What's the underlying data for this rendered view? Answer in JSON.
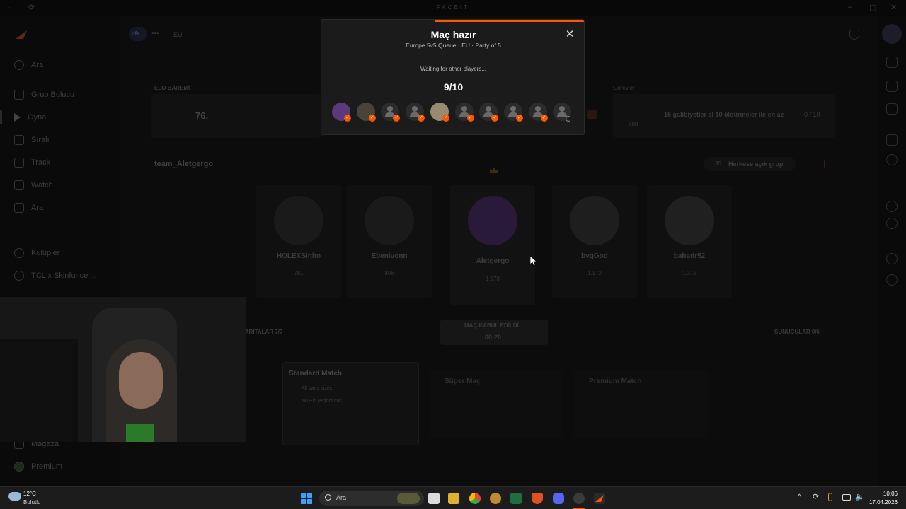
{
  "app": {
    "title": "FACEIT"
  },
  "sidebar": {
    "items": [
      {
        "label": "Ara"
      },
      {
        "label": "Grup Bulucu"
      },
      {
        "label": "Oyna"
      },
      {
        "label": "Sıralı"
      },
      {
        "label": "Track"
      },
      {
        "label": "Watch"
      },
      {
        "label": "Ara"
      },
      {
        "label": "Kulüpler"
      },
      {
        "label": "TCL x Skinfunce ..."
      },
      {
        "label": "Mağaza"
      },
      {
        "label": "Premium"
      }
    ]
  },
  "topbar": {
    "game_tag": "cfs",
    "region": "EU"
  },
  "stats": {
    "elo_label": "ELO BAREMİ",
    "elo_value": "76.",
    "mission_label": "Görevler",
    "mission_reward": "500",
    "mission_text": "15 galibiyetler al 10 öldürmeler ile en az",
    "mission_progress": "0 / 10"
  },
  "party": {
    "name": "team_Aletgergo",
    "open_label": "Herkese açık grup",
    "open_count": "35",
    "players": [
      {
        "name": "HOLEXSinho",
        "elo": "781"
      },
      {
        "name": "Ebenivonn",
        "elo": "806"
      },
      {
        "name": "Aletgergo",
        "elo": "1.178"
      },
      {
        "name": "bvgGod",
        "elo": "1.172"
      },
      {
        "name": "bahadr52",
        "elo": "1.372"
      }
    ]
  },
  "lower": {
    "maps_label": "HARİTALAR 7/7",
    "accepted_label": "MAÇ KABUL EDİLDİ",
    "accepted_timer": "00:20",
    "servers_label": "SUNUCULAR 0/6",
    "mode1_title": "Standard Match",
    "mode1_line1": "All party sizes",
    "mode1_line2": "No Elo restrictions",
    "mode2_title": "Süper Maç",
    "mode3_title": "Premium Match"
  },
  "modal": {
    "title": "Maç hazır",
    "subtitle": "Europe 5v5 Queue · EU · Party of 5",
    "waiting": "Waiting for other players...",
    "count": "9/10",
    "accepted": 9,
    "total": 10,
    "accent": "#ff5500"
  },
  "taskbar": {
    "weather_temp": "12°C",
    "weather_desc": "Bulutlu",
    "search_placeholder": "Ara",
    "time": "10:06",
    "date": "17.04.2026"
  }
}
